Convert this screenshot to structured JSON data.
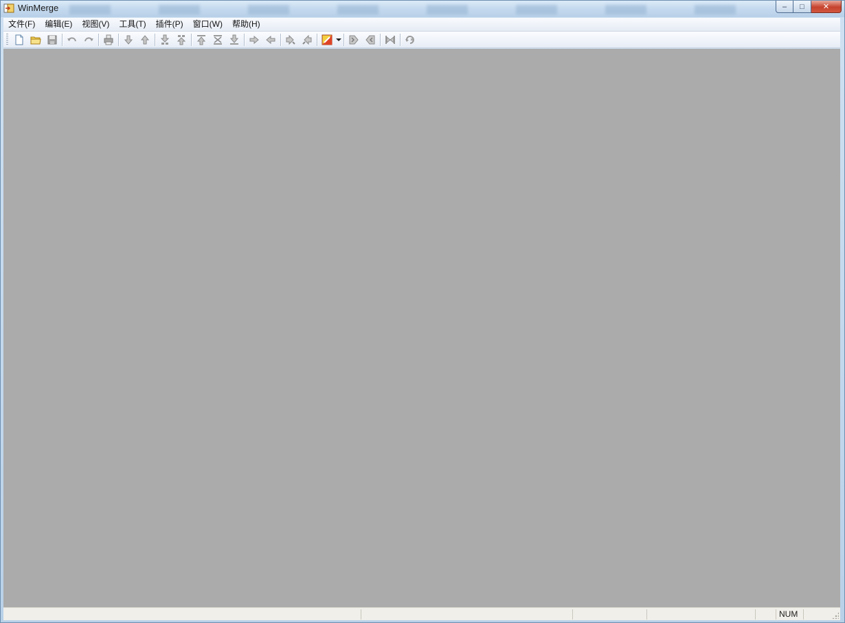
{
  "window": {
    "title": "WinMerge"
  },
  "caption_buttons": {
    "minimize": "–",
    "maximize": "□",
    "close": "✕"
  },
  "menu": {
    "items": [
      {
        "label": "文件(F)"
      },
      {
        "label": "编辑(E)"
      },
      {
        "label": "视图(V)"
      },
      {
        "label": "工具(T)"
      },
      {
        "label": "插件(P)"
      },
      {
        "label": "窗口(W)"
      },
      {
        "label": "帮助(H)"
      }
    ]
  },
  "toolbar": {
    "icons": [
      "new-document-icon",
      "open-folder-icon",
      "save-icon",
      "undo-icon",
      "redo-icon",
      "print-icon",
      "next-difference-icon",
      "previous-difference-icon",
      "next-conflict-icon",
      "previous-conflict-icon",
      "first-difference-icon",
      "current-difference-icon",
      "last-difference-icon",
      "copy-right-icon",
      "copy-left-icon",
      "copy-right-advance-icon",
      "copy-left-advance-icon",
      "options-icon",
      "dropdown-arrow-icon",
      "copy-all-right-icon",
      "copy-all-left-icon",
      "merge-all-icon",
      "refresh-icon"
    ]
  },
  "statusbar": {
    "num_indicator": "NUM"
  },
  "colors": {
    "client_background": "#ababab",
    "icon_gray": "#9a9a9a",
    "icon_yellow": "#e8c33a",
    "icon_red": "#d8402a"
  }
}
